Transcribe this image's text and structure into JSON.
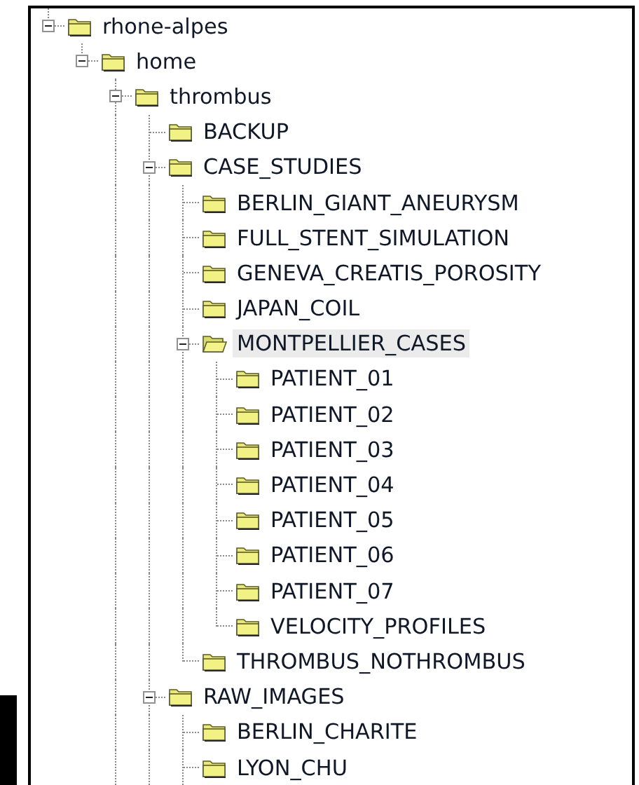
{
  "tree": [
    {
      "label": "rhone-alpes",
      "expanded": true,
      "selected": false,
      "children": [
        {
          "label": "home",
          "expanded": true,
          "selected": false,
          "truncated": true,
          "children": [
            {
              "label": "thrombus",
              "expanded": true,
              "selected": false,
              "truncated": true,
              "children": [
                {
                  "label": "BACKUP",
                  "selected": false
                },
                {
                  "label": "CASE_STUDIES",
                  "expanded": true,
                  "selected": false,
                  "children": [
                    {
                      "label": "BERLIN_GIANT_ANEURYSM",
                      "selected": false
                    },
                    {
                      "label": "FULL_STENT_SIMULATION",
                      "selected": false
                    },
                    {
                      "label": "GENEVA_CREATIS_POROSITY",
                      "selected": false
                    },
                    {
                      "label": "JAPAN_COIL",
                      "selected": false
                    },
                    {
                      "label": "MONTPELLIER_CASES",
                      "expanded": true,
                      "selected": true,
                      "children": [
                        {
                          "label": "PATIENT_01",
                          "selected": false
                        },
                        {
                          "label": "PATIENT_02",
                          "selected": false
                        },
                        {
                          "label": "PATIENT_03",
                          "selected": false
                        },
                        {
                          "label": "PATIENT_04",
                          "selected": false
                        },
                        {
                          "label": "PATIENT_05",
                          "selected": false
                        },
                        {
                          "label": "PATIENT_06",
                          "selected": false
                        },
                        {
                          "label": "PATIENT_07",
                          "selected": false
                        },
                        {
                          "label": "VELOCITY_PROFILES",
                          "selected": false
                        }
                      ]
                    },
                    {
                      "label": "THROMBUS_NOTHROMBUS",
                      "selected": false
                    }
                  ]
                },
                {
                  "label": "RAW_IMAGES",
                  "expanded": true,
                  "selected": false,
                  "truncated": true,
                  "children": [
                    {
                      "label": "BERLIN_CHARITE",
                      "selected": false
                    },
                    {
                      "label": "LYON_CHU",
                      "selected": false
                    }
                  ]
                }
              ]
            }
          ]
        }
      ]
    }
  ]
}
